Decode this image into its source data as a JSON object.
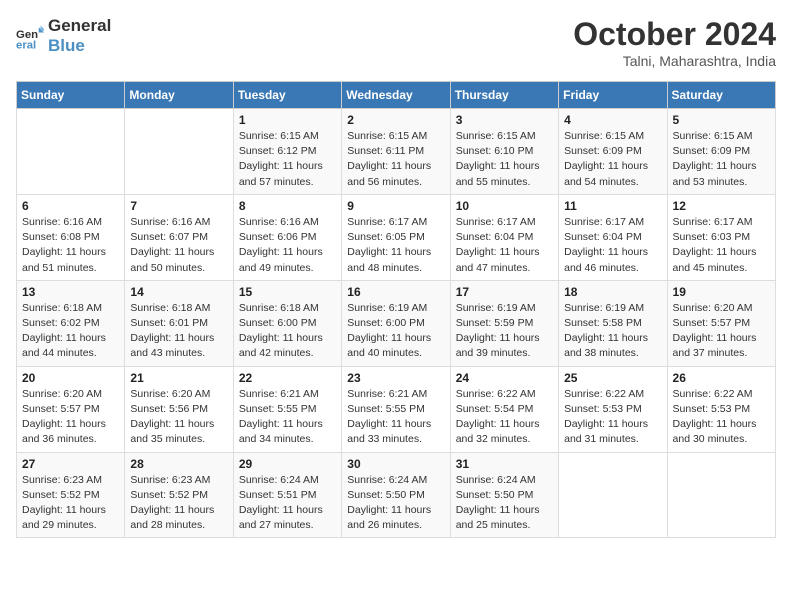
{
  "logo": {
    "text_general": "General",
    "text_blue": "Blue"
  },
  "title": "October 2024",
  "location": "Talni, Maharashtra, India",
  "weekdays": [
    "Sunday",
    "Monday",
    "Tuesday",
    "Wednesday",
    "Thursday",
    "Friday",
    "Saturday"
  ],
  "weeks": [
    [
      {
        "day": "",
        "sunrise": "",
        "sunset": "",
        "daylight": ""
      },
      {
        "day": "",
        "sunrise": "",
        "sunset": "",
        "daylight": ""
      },
      {
        "day": "1",
        "sunrise": "Sunrise: 6:15 AM",
        "sunset": "Sunset: 6:12 PM",
        "daylight": "Daylight: 11 hours and 57 minutes."
      },
      {
        "day": "2",
        "sunrise": "Sunrise: 6:15 AM",
        "sunset": "Sunset: 6:11 PM",
        "daylight": "Daylight: 11 hours and 56 minutes."
      },
      {
        "day": "3",
        "sunrise": "Sunrise: 6:15 AM",
        "sunset": "Sunset: 6:10 PM",
        "daylight": "Daylight: 11 hours and 55 minutes."
      },
      {
        "day": "4",
        "sunrise": "Sunrise: 6:15 AM",
        "sunset": "Sunset: 6:09 PM",
        "daylight": "Daylight: 11 hours and 54 minutes."
      },
      {
        "day": "5",
        "sunrise": "Sunrise: 6:15 AM",
        "sunset": "Sunset: 6:09 PM",
        "daylight": "Daylight: 11 hours and 53 minutes."
      }
    ],
    [
      {
        "day": "6",
        "sunrise": "Sunrise: 6:16 AM",
        "sunset": "Sunset: 6:08 PM",
        "daylight": "Daylight: 11 hours and 51 minutes."
      },
      {
        "day": "7",
        "sunrise": "Sunrise: 6:16 AM",
        "sunset": "Sunset: 6:07 PM",
        "daylight": "Daylight: 11 hours and 50 minutes."
      },
      {
        "day": "8",
        "sunrise": "Sunrise: 6:16 AM",
        "sunset": "Sunset: 6:06 PM",
        "daylight": "Daylight: 11 hours and 49 minutes."
      },
      {
        "day": "9",
        "sunrise": "Sunrise: 6:17 AM",
        "sunset": "Sunset: 6:05 PM",
        "daylight": "Daylight: 11 hours and 48 minutes."
      },
      {
        "day": "10",
        "sunrise": "Sunrise: 6:17 AM",
        "sunset": "Sunset: 6:04 PM",
        "daylight": "Daylight: 11 hours and 47 minutes."
      },
      {
        "day": "11",
        "sunrise": "Sunrise: 6:17 AM",
        "sunset": "Sunset: 6:04 PM",
        "daylight": "Daylight: 11 hours and 46 minutes."
      },
      {
        "day": "12",
        "sunrise": "Sunrise: 6:17 AM",
        "sunset": "Sunset: 6:03 PM",
        "daylight": "Daylight: 11 hours and 45 minutes."
      }
    ],
    [
      {
        "day": "13",
        "sunrise": "Sunrise: 6:18 AM",
        "sunset": "Sunset: 6:02 PM",
        "daylight": "Daylight: 11 hours and 44 minutes."
      },
      {
        "day": "14",
        "sunrise": "Sunrise: 6:18 AM",
        "sunset": "Sunset: 6:01 PM",
        "daylight": "Daylight: 11 hours and 43 minutes."
      },
      {
        "day": "15",
        "sunrise": "Sunrise: 6:18 AM",
        "sunset": "Sunset: 6:00 PM",
        "daylight": "Daylight: 11 hours and 42 minutes."
      },
      {
        "day": "16",
        "sunrise": "Sunrise: 6:19 AM",
        "sunset": "Sunset: 6:00 PM",
        "daylight": "Daylight: 11 hours and 40 minutes."
      },
      {
        "day": "17",
        "sunrise": "Sunrise: 6:19 AM",
        "sunset": "Sunset: 5:59 PM",
        "daylight": "Daylight: 11 hours and 39 minutes."
      },
      {
        "day": "18",
        "sunrise": "Sunrise: 6:19 AM",
        "sunset": "Sunset: 5:58 PM",
        "daylight": "Daylight: 11 hours and 38 minutes."
      },
      {
        "day": "19",
        "sunrise": "Sunrise: 6:20 AM",
        "sunset": "Sunset: 5:57 PM",
        "daylight": "Daylight: 11 hours and 37 minutes."
      }
    ],
    [
      {
        "day": "20",
        "sunrise": "Sunrise: 6:20 AM",
        "sunset": "Sunset: 5:57 PM",
        "daylight": "Daylight: 11 hours and 36 minutes."
      },
      {
        "day": "21",
        "sunrise": "Sunrise: 6:20 AM",
        "sunset": "Sunset: 5:56 PM",
        "daylight": "Daylight: 11 hours and 35 minutes."
      },
      {
        "day": "22",
        "sunrise": "Sunrise: 6:21 AM",
        "sunset": "Sunset: 5:55 PM",
        "daylight": "Daylight: 11 hours and 34 minutes."
      },
      {
        "day": "23",
        "sunrise": "Sunrise: 6:21 AM",
        "sunset": "Sunset: 5:55 PM",
        "daylight": "Daylight: 11 hours and 33 minutes."
      },
      {
        "day": "24",
        "sunrise": "Sunrise: 6:22 AM",
        "sunset": "Sunset: 5:54 PM",
        "daylight": "Daylight: 11 hours and 32 minutes."
      },
      {
        "day": "25",
        "sunrise": "Sunrise: 6:22 AM",
        "sunset": "Sunset: 5:53 PM",
        "daylight": "Daylight: 11 hours and 31 minutes."
      },
      {
        "day": "26",
        "sunrise": "Sunrise: 6:22 AM",
        "sunset": "Sunset: 5:53 PM",
        "daylight": "Daylight: 11 hours and 30 minutes."
      }
    ],
    [
      {
        "day": "27",
        "sunrise": "Sunrise: 6:23 AM",
        "sunset": "Sunset: 5:52 PM",
        "daylight": "Daylight: 11 hours and 29 minutes."
      },
      {
        "day": "28",
        "sunrise": "Sunrise: 6:23 AM",
        "sunset": "Sunset: 5:52 PM",
        "daylight": "Daylight: 11 hours and 28 minutes."
      },
      {
        "day": "29",
        "sunrise": "Sunrise: 6:24 AM",
        "sunset": "Sunset: 5:51 PM",
        "daylight": "Daylight: 11 hours and 27 minutes."
      },
      {
        "day": "30",
        "sunrise": "Sunrise: 6:24 AM",
        "sunset": "Sunset: 5:50 PM",
        "daylight": "Daylight: 11 hours and 26 minutes."
      },
      {
        "day": "31",
        "sunrise": "Sunrise: 6:24 AM",
        "sunset": "Sunset: 5:50 PM",
        "daylight": "Daylight: 11 hours and 25 minutes."
      },
      {
        "day": "",
        "sunrise": "",
        "sunset": "",
        "daylight": ""
      },
      {
        "day": "",
        "sunrise": "",
        "sunset": "",
        "daylight": ""
      }
    ]
  ]
}
